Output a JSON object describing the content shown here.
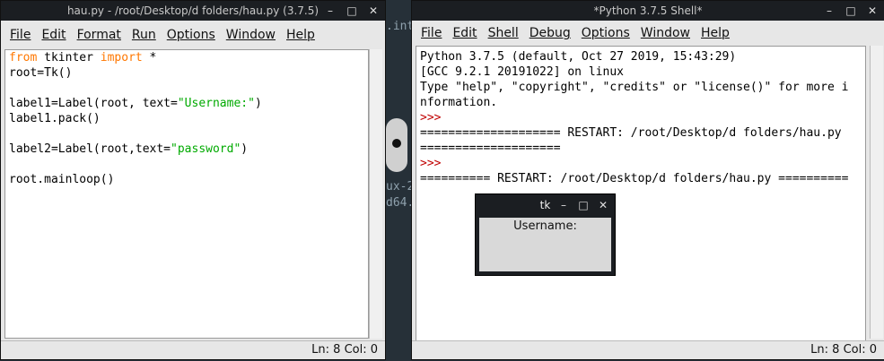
{
  "editor_window": {
    "title": "hau.py - /root/Desktop/d folders/hau.py (3.7.5)",
    "menus": [
      "File",
      "Edit",
      "Format",
      "Run",
      "Options",
      "Window",
      "Help"
    ],
    "status": "Ln: 8  Col: 0",
    "code_lines": [
      [
        {
          "t": "from",
          "c": "kw"
        },
        {
          "t": " tkinter ",
          "c": ""
        },
        {
          "t": "import",
          "c": "kw"
        },
        {
          "t": " *",
          "c": ""
        }
      ],
      [
        {
          "t": "root=Tk()",
          "c": ""
        }
      ],
      [],
      [
        {
          "t": "label1=Label(root, text=",
          "c": ""
        },
        {
          "t": "\"Username:\"",
          "c": "str"
        },
        {
          "t": ")",
          "c": ""
        }
      ],
      [
        {
          "t": "label1.pack()",
          "c": ""
        }
      ],
      [],
      [
        {
          "t": "label2=Label(root,text=",
          "c": ""
        },
        {
          "t": "\"password\"",
          "c": "str"
        },
        {
          "t": ")",
          "c": ""
        }
      ],
      [],
      [
        {
          "t": "root.mainloop()",
          "c": ""
        }
      ]
    ]
  },
  "shell_window": {
    "title": "*Python 3.7.5 Shell*",
    "menus": [
      "File",
      "Edit",
      "Shell",
      "Debug",
      "Options",
      "Window",
      "Help"
    ],
    "status": "Ln: 8  Col: 0",
    "lines": [
      [
        {
          "t": "Python 3.7.5 (default, Oct 27 2019, 15:43:29)",
          "c": ""
        }
      ],
      [
        {
          "t": "[GCC 9.2.1 20191022] on linux",
          "c": ""
        }
      ],
      [
        {
          "t": "Type \"help\", \"copyright\", \"credits\" or \"license()\" for more i",
          "c": ""
        }
      ],
      [
        {
          "t": "nformation.",
          "c": ""
        }
      ],
      [
        {
          "t": ">>>",
          "c": "prompt"
        }
      ],
      [
        {
          "t": "==================== RESTART: /root/Desktop/d folders/hau.py",
          "c": ""
        }
      ],
      [
        {
          "t": "====================",
          "c": ""
        }
      ],
      [
        {
          "t": ">>>",
          "c": "prompt"
        }
      ],
      [
        {
          "t": "========== RESTART: /root/Desktop/d folders/hau.py ==========",
          "c": ""
        }
      ]
    ]
  },
  "tk_window": {
    "title": "tk",
    "label": "Username:"
  },
  "background_text": {
    "a": ".inte",
    "b": "ux-2",
    "c": "d64."
  }
}
